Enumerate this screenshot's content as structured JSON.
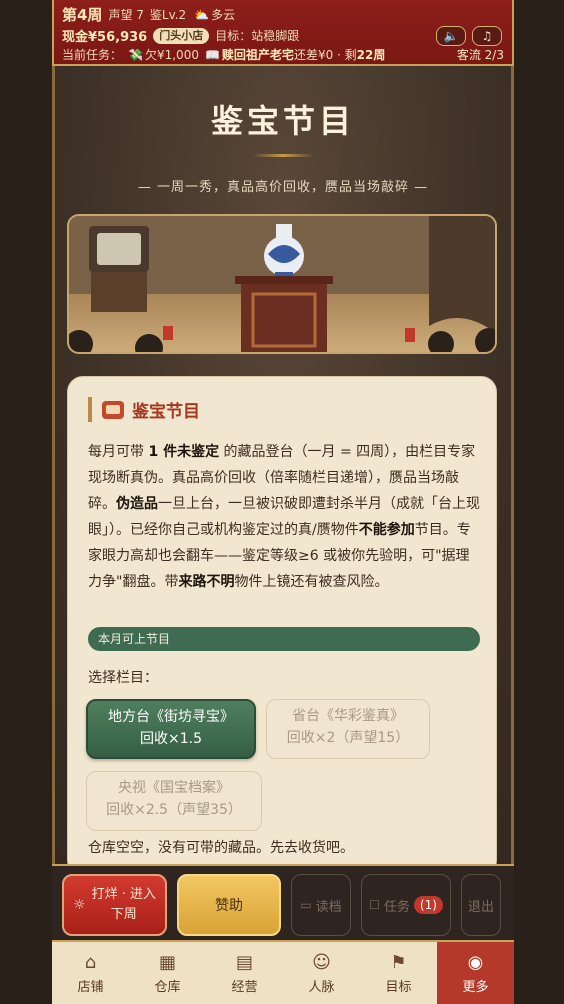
{
  "status": {
    "week": "第4周",
    "reputation": "声望 7",
    "appraisal_level": "鉴Lv.2",
    "weather": "多云",
    "cash": "现金¥56,936",
    "shop_badge": "门头小店",
    "goal_label": "目标：站稳脚跟",
    "task_prefix": "当前任务：",
    "debt": "欠¥1,000",
    "mission_title": "赎回祖产老宅",
    "mission_rest": "还差¥0 · 剩",
    "mission_weeks": "22周",
    "guests": "客流 2/3",
    "sound_icon": "speaker-icon",
    "music_icon": "music-note-icon"
  },
  "main": {
    "title": "鉴宝节目",
    "subtitle": "— 一周一秀，真品高价回收，赝品当场敲碎 —"
  },
  "card": {
    "title": "鉴宝节目",
    "p1": "每月可带 ",
    "p1_bold": "1 件未鉴定",
    "p2": " 的藏品登台（一月 = 四周），由栏目专家现场断真伪。真品高价回收（倍率随栏目递增），赝品当场敲碎。",
    "p2_bold": "伪造品",
    "p3": "一旦上台，一旦被识破即遭封杀半月（成就「台上现眼」）。已经你自己或机构鉴定过的真/赝物件",
    "p3_bold": "不能参加",
    "p4": "节目。专家眼力高却也会翻车——鉴定等级≥6 或被你先验明，可\"据理力争\"翻盘。带",
    "p4_bold": "来路不明",
    "p5": "物件上镜还有被查风险。",
    "month_bar": "本月可上节目",
    "choose_label": "选择栏目：",
    "choices": [
      {
        "line1": "地方台《街坊寻宝》",
        "line2": "回收×1.5",
        "state": "active"
      },
      {
        "line1": "省台《华彩鉴真》",
        "line2": "回收×2（声望15）",
        "state": "disabled"
      },
      {
        "line1": "央视《国宝档案》",
        "line2": "回收×2.5（声望35）",
        "state": "disabled"
      }
    ],
    "empty_note": "仓库空空，没有可带的藏品。先去收货吧。"
  },
  "actions": {
    "close_next": "打烊 · 进入\n下周",
    "sponsor": "赞助",
    "load": "读档",
    "tasks": "任务",
    "task_count": "(1)",
    "exit": "退出"
  },
  "nav": [
    {
      "label": "店铺",
      "icon": "shop-icon"
    },
    {
      "label": "仓库",
      "icon": "warehouse-icon"
    },
    {
      "label": "经营",
      "icon": "ledger-icon"
    },
    {
      "label": "人脉",
      "icon": "people-icon"
    },
    {
      "label": "目标",
      "icon": "flag-icon"
    },
    {
      "label": "更多",
      "icon": "more-icon"
    }
  ],
  "colors": {
    "accent_red": "#8e1f1a",
    "gold": "#c9a25a",
    "active_green": "#355f44"
  }
}
